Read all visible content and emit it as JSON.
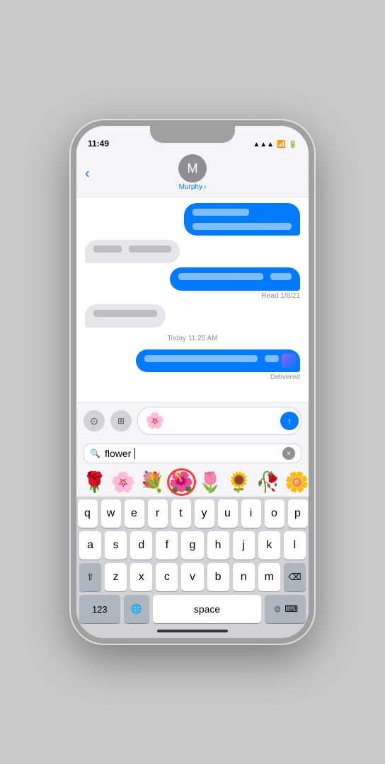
{
  "status_bar": {
    "time": "11:49",
    "signal_icon": "▲",
    "wifi_icon": "wifi",
    "battery_icon": "battery"
  },
  "header": {
    "back_label": "‹",
    "avatar_initial": "M",
    "contact_name": "Murphy",
    "chevron": "›"
  },
  "messages": [
    {
      "type": "outgoing",
      "blurs": [
        80,
        140
      ],
      "id": "msg1"
    },
    {
      "type": "incoming",
      "blurs": [
        40,
        60
      ],
      "id": "msg2"
    },
    {
      "type": "outgoing",
      "blurs": [
        120,
        30
      ],
      "id": "msg3"
    },
    {
      "type": "status",
      "text": "Read 1/8/21",
      "id": "status1"
    },
    {
      "type": "incoming",
      "blurs": [
        90
      ],
      "id": "msg4"
    },
    {
      "type": "section",
      "text": "Today 11:25 AM",
      "id": "today1"
    },
    {
      "type": "outgoing",
      "blurs": [
        160,
        20
      ],
      "id": "msg5"
    },
    {
      "type": "delivered",
      "text": "Delivered",
      "id": "delivered1"
    }
  ],
  "input": {
    "flower_emoji": "🌸",
    "send_icon": "↑",
    "camera_icon": "⊙",
    "apps_icon": "⊞"
  },
  "emoji_search": {
    "placeholder": "flower",
    "cursor": "|",
    "clear_icon": "×",
    "search_icon": "⌕"
  },
  "emoji_results": [
    {
      "emoji": "🌹",
      "highlighted": false
    },
    {
      "emoji": "🌸",
      "highlighted": false
    },
    {
      "emoji": "💐",
      "highlighted": false
    },
    {
      "emoji": "🌺",
      "highlighted": true
    },
    {
      "emoji": "🌷",
      "highlighted": false
    },
    {
      "emoji": "🌻",
      "highlighted": false
    },
    {
      "emoji": "🥀",
      "highlighted": false
    },
    {
      "emoji": "🌼",
      "highlighted": false
    }
  ],
  "keyboard": {
    "rows": [
      [
        "q",
        "w",
        "e",
        "r",
        "t",
        "y",
        "u",
        "i",
        "o",
        "p"
      ],
      [
        "a",
        "s",
        "d",
        "f",
        "g",
        "h",
        "j",
        "k",
        "l"
      ],
      [
        "z",
        "x",
        "c",
        "v",
        "b",
        "n",
        "m"
      ]
    ],
    "numbers_label": "123",
    "space_label": "space",
    "delete_icon": "⌫",
    "shift_icon": "⇧",
    "emoji_icon": "🌐"
  },
  "home_indicator": {}
}
